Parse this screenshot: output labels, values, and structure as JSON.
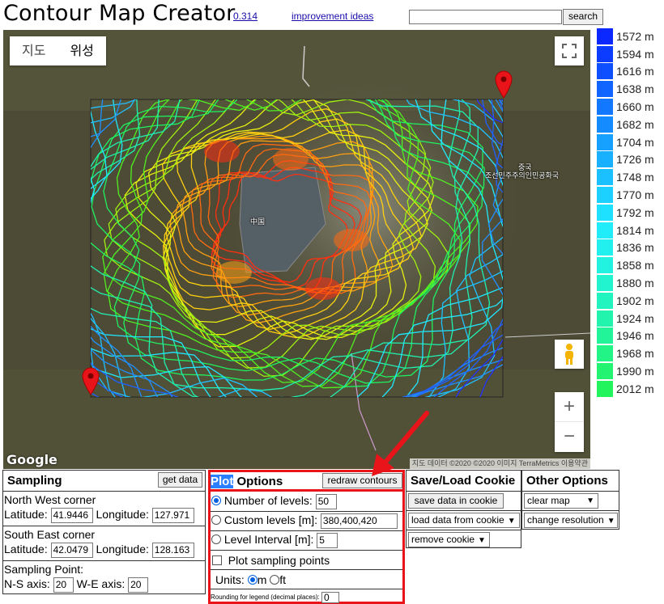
{
  "header": {
    "title": "Contour Map Creator",
    "version_link": "0.314",
    "ideas_link": "improvement ideas",
    "search": {
      "value": "",
      "button": "search"
    }
  },
  "map": {
    "map_types": [
      "지도",
      "위성"
    ],
    "selected_map_type": "지도",
    "labels": {
      "china": "中国",
      "korea": "조선민주주의인민공화국",
      "korea_short": "중국"
    },
    "google": "Google",
    "attribution": "지도 데이터 ©2020 ©2020 이미지 TerraMetrics   이용약관",
    "zoom_in": "+",
    "zoom_out": "−",
    "icons": [
      "fullscreen-icon",
      "pegman-icon",
      "map-marker-icon"
    ]
  },
  "legend": {
    "unit": "m",
    "entries": [
      {
        "value": "1572 m",
        "color": "#0a28ff"
      },
      {
        "value": "1594 m",
        "color": "#0c3cff"
      },
      {
        "value": "1616 m",
        "color": "#0e50ff"
      },
      {
        "value": "1638 m",
        "color": "#1064ff"
      },
      {
        "value": "1660 m",
        "color": "#1278ff"
      },
      {
        "value": "1682 m",
        "color": "#148cff"
      },
      {
        "value": "1704 m",
        "color": "#16a0ff"
      },
      {
        "value": "1726 m",
        "color": "#18b0ff"
      },
      {
        "value": "1748 m",
        "color": "#1ac0ff"
      },
      {
        "value": "1770 m",
        "color": "#1cd0ff"
      },
      {
        "value": "1792 m",
        "color": "#1ee0ff"
      },
      {
        "value": "1814 m",
        "color": "#20ecfa"
      },
      {
        "value": "1836 m",
        "color": "#22f0ee"
      },
      {
        "value": "1858 m",
        "color": "#22f2e0"
      },
      {
        "value": "1880 m",
        "color": "#22f4d0"
      },
      {
        "value": "1902 m",
        "color": "#22f4c0"
      },
      {
        "value": "1924 m",
        "color": "#22f4ae"
      },
      {
        "value": "1946 m",
        "color": "#22f49a"
      },
      {
        "value": "1968 m",
        "color": "#22f486"
      },
      {
        "value": "1990 m",
        "color": "#22f472"
      },
      {
        "value": "2012 m",
        "color": "#22f45e"
      }
    ]
  },
  "sampling": {
    "title": "Sampling",
    "get_data": "get data",
    "nw_label": "North West corner",
    "nw_lat_label": "Latitude:",
    "nw_lat": "41.9446",
    "nw_lng_label": "Longitude:",
    "nw_lng": "127.971",
    "se_label": "South East corner",
    "se_lat_label": "Latitude:",
    "se_lat": "42.0479",
    "se_lng_label": "Longitude:",
    "se_lng": "128.163",
    "point_label": "Sampling Point:",
    "ns_label": "N-S axis:",
    "ns_value": "20",
    "we_label": "W-E axis:",
    "we_value": "20"
  },
  "plot": {
    "title_highlight": "Plot",
    "title_rest": " Options",
    "redraw": "redraw contours",
    "levels_label": "Number of levels:",
    "levels_value": "50",
    "custom_label": "Custom levels [m]:",
    "custom_value": "380,400,420",
    "interval_label": "Level Interval [m]:",
    "interval_value": "5",
    "sampling_points_label": "Plot sampling points",
    "units_label": "Units:",
    "unit_m": "m",
    "unit_ft": "ft",
    "rounding_label": "Rounding for legend (decimal places):",
    "rounding_value": "0"
  },
  "cookie": {
    "title": "Save/Load Cookie",
    "save": "save data in cookie",
    "load": "load data from cookie",
    "remove": "remove cookie"
  },
  "other": {
    "title": "Other Options",
    "clear_map": "clear map",
    "change_resolution": "change resolution"
  },
  "colors": {
    "annotation_red": "#e8141a",
    "link": "#1a0dab"
  }
}
